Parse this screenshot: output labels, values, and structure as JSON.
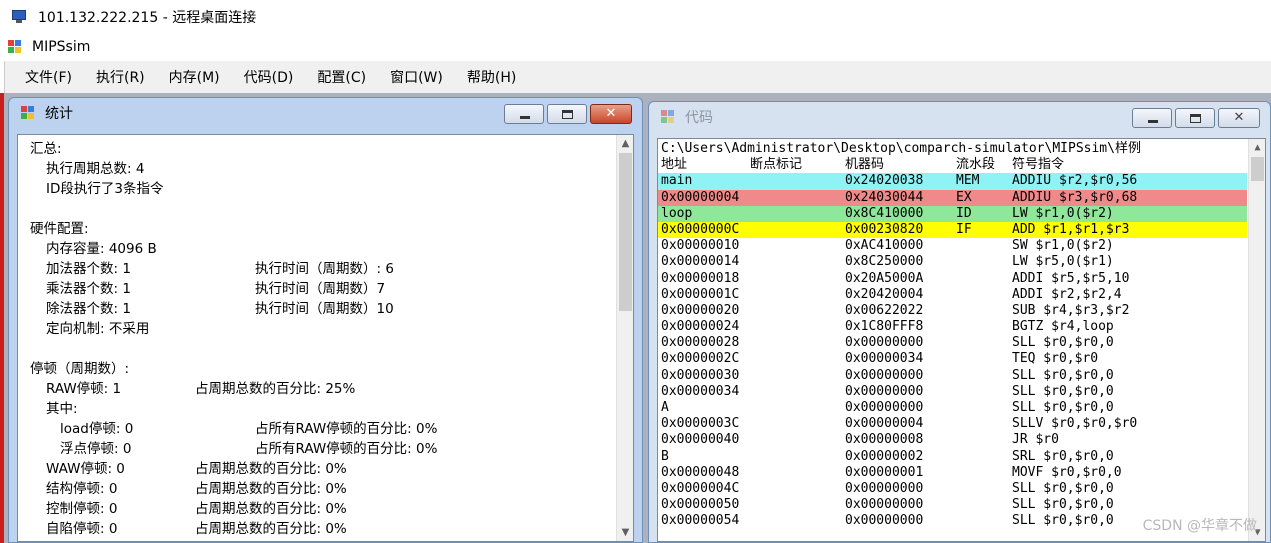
{
  "remote": {
    "title": "101.132.222.215 - 远程桌面连接"
  },
  "app": {
    "title": "MIPSsim"
  },
  "menu": [
    "文件(F)",
    "执行(R)",
    "内存(M)",
    "代码(D)",
    "配置(C)",
    "窗口(W)",
    "帮助(H)"
  ],
  "stats_window": {
    "title": "统计",
    "lines": [
      {
        "left": "汇总:",
        "indent": 0
      },
      {
        "left": "执行周期总数: 4",
        "indent": 1
      },
      {
        "left": "ID段执行了3条指令",
        "indent": 1
      },
      {
        "left": "",
        "indent": 0
      },
      {
        "left": "硬件配置:",
        "indent": 0
      },
      {
        "left": "内存容量: 4096 B",
        "indent": 1
      },
      {
        "left": "加法器个数: 1",
        "right": "执行时间（周期数）: 6",
        "indent": 1,
        "rcol": 2
      },
      {
        "left": "乘法器个数: 1",
        "right": "执行时间（周期数）7",
        "indent": 1,
        "rcol": 2
      },
      {
        "left": "除法器个数: 1",
        "right": "执行时间（周期数）10",
        "indent": 1,
        "rcol": 2
      },
      {
        "left": "定向机制: 不采用",
        "indent": 1
      },
      {
        "left": "",
        "indent": 0
      },
      {
        "left": "停顿（周期数）:",
        "indent": 0
      },
      {
        "left": "RAW停顿: 1",
        "right": "占周期总数的百分比: 25%",
        "indent": 1,
        "rcol": 1
      },
      {
        "left": "其中:",
        "indent": 1
      },
      {
        "left": "load停顿: 0",
        "right": "占所有RAW停顿的百分比: 0%",
        "indent": 2,
        "rcol": 2
      },
      {
        "left": "浮点停顿: 0",
        "right": "占所有RAW停顿的百分比: 0%",
        "indent": 2,
        "rcol": 2
      },
      {
        "left": "WAW停顿: 0",
        "right": "占周期总数的百分比: 0%",
        "indent": 1,
        "rcol": 1
      },
      {
        "left": "结构停顿: 0",
        "right": "占周期总数的百分比: 0%",
        "indent": 1,
        "rcol": 1
      },
      {
        "left": "控制停顿: 0",
        "right": "占周期总数的百分比: 0%",
        "indent": 1,
        "rcol": 1
      },
      {
        "left": "自陷停顿: 0",
        "right": "占周期总数的百分比: 0%",
        "indent": 1,
        "rcol": 1
      }
    ]
  },
  "code_window": {
    "title": "代码",
    "path": "C:\\Users\\Administrator\\Desktop\\comparch-simulator\\MIPSsim\\样例",
    "headers": {
      "addr": "地址",
      "bp": "断点标记",
      "mc": "机器码",
      "stage": "流水段",
      "instr": "符号指令"
    },
    "rows": [
      {
        "addr": "main",
        "mc": "0x24020038",
        "stage": "MEM",
        "instr": "ADDIU $r2,$r0,56",
        "hl": "#8ff3f6"
      },
      {
        "addr": "0x00000004",
        "mc": "0x24030044",
        "stage": "EX",
        "instr": "ADDIU $r3,$r0,68",
        "hl": "#f08a8a"
      },
      {
        "addr": "loop",
        "mc": "0x8C410000",
        "stage": "ID",
        "instr": "LW $r1,0($r2)",
        "hl": "#8fe89a"
      },
      {
        "addr": "0x0000000C",
        "mc": "0x00230820",
        "stage": "IF",
        "instr": "ADD $r1,$r1,$r3",
        "hl": "#ffff00"
      },
      {
        "addr": "0x00000010",
        "mc": "0xAC410000",
        "stage": "",
        "instr": "SW $r1,0($r2)",
        "hl": ""
      },
      {
        "addr": "0x00000014",
        "mc": "0x8C250000",
        "stage": "",
        "instr": "LW $r5,0($r1)",
        "hl": ""
      },
      {
        "addr": "0x00000018",
        "mc": "0x20A5000A",
        "stage": "",
        "instr": "ADDI $r5,$r5,10",
        "hl": ""
      },
      {
        "addr": "0x0000001C",
        "mc": "0x20420004",
        "stage": "",
        "instr": "ADDI $r2,$r2,4",
        "hl": ""
      },
      {
        "addr": "0x00000020",
        "mc": "0x00622022",
        "stage": "",
        "instr": "SUB $r4,$r3,$r2",
        "hl": ""
      },
      {
        "addr": "0x00000024",
        "mc": "0x1C80FFF8",
        "stage": "",
        "instr": "BGTZ $r4,loop",
        "hl": ""
      },
      {
        "addr": "0x00000028",
        "mc": "0x00000000",
        "stage": "",
        "instr": "SLL $r0,$r0,0",
        "hl": ""
      },
      {
        "addr": "0x0000002C",
        "mc": "0x00000034",
        "stage": "",
        "instr": "TEQ $r0,$r0",
        "hl": ""
      },
      {
        "addr": "0x00000030",
        "mc": "0x00000000",
        "stage": "",
        "instr": "SLL $r0,$r0,0",
        "hl": ""
      },
      {
        "addr": "0x00000034",
        "mc": "0x00000000",
        "stage": "",
        "instr": "SLL $r0,$r0,0",
        "hl": ""
      },
      {
        "addr": "A",
        "mc": "0x00000000",
        "stage": "",
        "instr": "SLL $r0,$r0,0",
        "hl": ""
      },
      {
        "addr": "0x0000003C",
        "mc": "0x00000004",
        "stage": "",
        "instr": "SLLV $r0,$r0,$r0",
        "hl": ""
      },
      {
        "addr": "0x00000040",
        "mc": "0x00000008",
        "stage": "",
        "instr": "JR $r0",
        "hl": ""
      },
      {
        "addr": "B",
        "mc": "0x00000002",
        "stage": "",
        "instr": "SRL $r0,$r0,0",
        "hl": ""
      },
      {
        "addr": "0x00000048",
        "mc": "0x00000001",
        "stage": "",
        "instr": "MOVF $r0,$r0,0",
        "hl": ""
      },
      {
        "addr": "0x0000004C",
        "mc": "0x00000000",
        "stage": "",
        "instr": "SLL $r0,$r0,0",
        "hl": ""
      },
      {
        "addr": "0x00000050",
        "mc": "0x00000000",
        "stage": "",
        "instr": "SLL $r0,$r0,0",
        "hl": ""
      },
      {
        "addr": "0x00000054",
        "mc": "0x00000000",
        "stage": "",
        "instr": "SLL $r0,$r0,0",
        "hl": ""
      }
    ]
  },
  "watermark": "CSDN @华章不做",
  "colors": {
    "mdi_bg": "#abb2bd",
    "titlebar": "#bcd2ee"
  }
}
